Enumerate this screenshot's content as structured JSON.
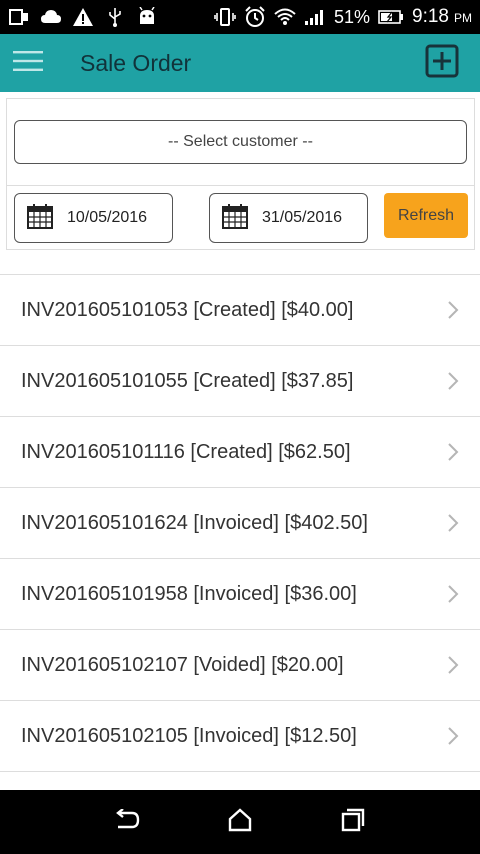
{
  "status_bar": {
    "battery_percent": "51%",
    "time": "9:18",
    "ampm": "PM",
    "icons": [
      "screen-mirror-icon",
      "cloud-icon",
      "warning-icon",
      "usb-icon",
      "android-icon",
      "vibrate-icon",
      "alarm-icon",
      "wifi-icon",
      "signal-icon",
      "battery-icon"
    ]
  },
  "app_bar": {
    "title": "Sale Order",
    "color": "#1fa2a4",
    "icons": [
      "menu-icon",
      "add-box-icon"
    ]
  },
  "filter": {
    "customer_placeholder": "-- Select customer --",
    "date_from": "10/05/2016",
    "date_to": "31/05/2016",
    "refresh_label": "Refresh",
    "refresh_color": "#f7a31c"
  },
  "orders": [
    {
      "label": "INV201605101053 [Created] [$40.00]"
    },
    {
      "label": "INV201605101055 [Created] [$37.85]"
    },
    {
      "label": "INV201605101116 [Created] [$62.50]"
    },
    {
      "label": "INV201605101624 [Invoiced] [$402.50]"
    },
    {
      "label": "INV201605101958 [Invoiced] [$36.00]"
    },
    {
      "label": "INV201605102107 [Voided] [$20.00]"
    },
    {
      "label": "INV201605102105 [Invoiced] [$12.50]"
    }
  ],
  "nav_bar": {
    "icons": [
      "back-icon",
      "home-icon",
      "recents-icon"
    ]
  }
}
